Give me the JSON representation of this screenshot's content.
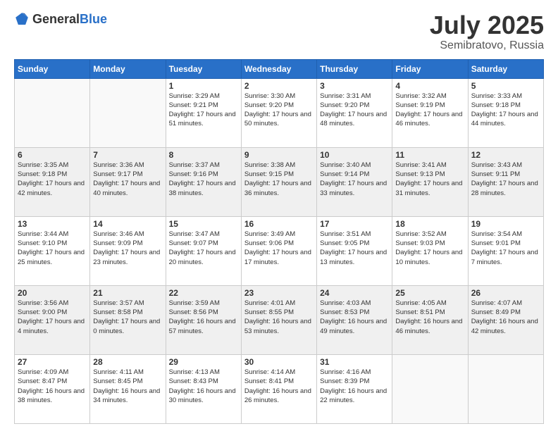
{
  "header": {
    "logo_general": "General",
    "logo_blue": "Blue",
    "title": "July 2025",
    "subtitle": "Semibratovo, Russia"
  },
  "days_of_week": [
    "Sunday",
    "Monday",
    "Tuesday",
    "Wednesday",
    "Thursday",
    "Friday",
    "Saturday"
  ],
  "weeks": [
    [
      {
        "day": "",
        "sunrise": "",
        "sunset": "",
        "daylight": "",
        "empty": true
      },
      {
        "day": "",
        "sunrise": "",
        "sunset": "",
        "daylight": "",
        "empty": true
      },
      {
        "day": "1",
        "sunrise": "Sunrise: 3:29 AM",
        "sunset": "Sunset: 9:21 PM",
        "daylight": "Daylight: 17 hours and 51 minutes.",
        "empty": false
      },
      {
        "day": "2",
        "sunrise": "Sunrise: 3:30 AM",
        "sunset": "Sunset: 9:20 PM",
        "daylight": "Daylight: 17 hours and 50 minutes.",
        "empty": false
      },
      {
        "day": "3",
        "sunrise": "Sunrise: 3:31 AM",
        "sunset": "Sunset: 9:20 PM",
        "daylight": "Daylight: 17 hours and 48 minutes.",
        "empty": false
      },
      {
        "day": "4",
        "sunrise": "Sunrise: 3:32 AM",
        "sunset": "Sunset: 9:19 PM",
        "daylight": "Daylight: 17 hours and 46 minutes.",
        "empty": false
      },
      {
        "day": "5",
        "sunrise": "Sunrise: 3:33 AM",
        "sunset": "Sunset: 9:18 PM",
        "daylight": "Daylight: 17 hours and 44 minutes.",
        "empty": false
      }
    ],
    [
      {
        "day": "6",
        "sunrise": "Sunrise: 3:35 AM",
        "sunset": "Sunset: 9:18 PM",
        "daylight": "Daylight: 17 hours and 42 minutes.",
        "empty": false
      },
      {
        "day": "7",
        "sunrise": "Sunrise: 3:36 AM",
        "sunset": "Sunset: 9:17 PM",
        "daylight": "Daylight: 17 hours and 40 minutes.",
        "empty": false
      },
      {
        "day": "8",
        "sunrise": "Sunrise: 3:37 AM",
        "sunset": "Sunset: 9:16 PM",
        "daylight": "Daylight: 17 hours and 38 minutes.",
        "empty": false
      },
      {
        "day": "9",
        "sunrise": "Sunrise: 3:38 AM",
        "sunset": "Sunset: 9:15 PM",
        "daylight": "Daylight: 17 hours and 36 minutes.",
        "empty": false
      },
      {
        "day": "10",
        "sunrise": "Sunrise: 3:40 AM",
        "sunset": "Sunset: 9:14 PM",
        "daylight": "Daylight: 17 hours and 33 minutes.",
        "empty": false
      },
      {
        "day": "11",
        "sunrise": "Sunrise: 3:41 AM",
        "sunset": "Sunset: 9:13 PM",
        "daylight": "Daylight: 17 hours and 31 minutes.",
        "empty": false
      },
      {
        "day": "12",
        "sunrise": "Sunrise: 3:43 AM",
        "sunset": "Sunset: 9:11 PM",
        "daylight": "Daylight: 17 hours and 28 minutes.",
        "empty": false
      }
    ],
    [
      {
        "day": "13",
        "sunrise": "Sunrise: 3:44 AM",
        "sunset": "Sunset: 9:10 PM",
        "daylight": "Daylight: 17 hours and 25 minutes.",
        "empty": false
      },
      {
        "day": "14",
        "sunrise": "Sunrise: 3:46 AM",
        "sunset": "Sunset: 9:09 PM",
        "daylight": "Daylight: 17 hours and 23 minutes.",
        "empty": false
      },
      {
        "day": "15",
        "sunrise": "Sunrise: 3:47 AM",
        "sunset": "Sunset: 9:07 PM",
        "daylight": "Daylight: 17 hours and 20 minutes.",
        "empty": false
      },
      {
        "day": "16",
        "sunrise": "Sunrise: 3:49 AM",
        "sunset": "Sunset: 9:06 PM",
        "daylight": "Daylight: 17 hours and 17 minutes.",
        "empty": false
      },
      {
        "day": "17",
        "sunrise": "Sunrise: 3:51 AM",
        "sunset": "Sunset: 9:05 PM",
        "daylight": "Daylight: 17 hours and 13 minutes.",
        "empty": false
      },
      {
        "day": "18",
        "sunrise": "Sunrise: 3:52 AM",
        "sunset": "Sunset: 9:03 PM",
        "daylight": "Daylight: 17 hours and 10 minutes.",
        "empty": false
      },
      {
        "day": "19",
        "sunrise": "Sunrise: 3:54 AM",
        "sunset": "Sunset: 9:01 PM",
        "daylight": "Daylight: 17 hours and 7 minutes.",
        "empty": false
      }
    ],
    [
      {
        "day": "20",
        "sunrise": "Sunrise: 3:56 AM",
        "sunset": "Sunset: 9:00 PM",
        "daylight": "Daylight: 17 hours and 4 minutes.",
        "empty": false
      },
      {
        "day": "21",
        "sunrise": "Sunrise: 3:57 AM",
        "sunset": "Sunset: 8:58 PM",
        "daylight": "Daylight: 17 hours and 0 minutes.",
        "empty": false
      },
      {
        "day": "22",
        "sunrise": "Sunrise: 3:59 AM",
        "sunset": "Sunset: 8:56 PM",
        "daylight": "Daylight: 16 hours and 57 minutes.",
        "empty": false
      },
      {
        "day": "23",
        "sunrise": "Sunrise: 4:01 AM",
        "sunset": "Sunset: 8:55 PM",
        "daylight": "Daylight: 16 hours and 53 minutes.",
        "empty": false
      },
      {
        "day": "24",
        "sunrise": "Sunrise: 4:03 AM",
        "sunset": "Sunset: 8:53 PM",
        "daylight": "Daylight: 16 hours and 49 minutes.",
        "empty": false
      },
      {
        "day": "25",
        "sunrise": "Sunrise: 4:05 AM",
        "sunset": "Sunset: 8:51 PM",
        "daylight": "Daylight: 16 hours and 46 minutes.",
        "empty": false
      },
      {
        "day": "26",
        "sunrise": "Sunrise: 4:07 AM",
        "sunset": "Sunset: 8:49 PM",
        "daylight": "Daylight: 16 hours and 42 minutes.",
        "empty": false
      }
    ],
    [
      {
        "day": "27",
        "sunrise": "Sunrise: 4:09 AM",
        "sunset": "Sunset: 8:47 PM",
        "daylight": "Daylight: 16 hours and 38 minutes.",
        "empty": false
      },
      {
        "day": "28",
        "sunrise": "Sunrise: 4:11 AM",
        "sunset": "Sunset: 8:45 PM",
        "daylight": "Daylight: 16 hours and 34 minutes.",
        "empty": false
      },
      {
        "day": "29",
        "sunrise": "Sunrise: 4:13 AM",
        "sunset": "Sunset: 8:43 PM",
        "daylight": "Daylight: 16 hours and 30 minutes.",
        "empty": false
      },
      {
        "day": "30",
        "sunrise": "Sunrise: 4:14 AM",
        "sunset": "Sunset: 8:41 PM",
        "daylight": "Daylight: 16 hours and 26 minutes.",
        "empty": false
      },
      {
        "day": "31",
        "sunrise": "Sunrise: 4:16 AM",
        "sunset": "Sunset: 8:39 PM",
        "daylight": "Daylight: 16 hours and 22 minutes.",
        "empty": false
      },
      {
        "day": "",
        "sunrise": "",
        "sunset": "",
        "daylight": "",
        "empty": true
      },
      {
        "day": "",
        "sunrise": "",
        "sunset": "",
        "daylight": "",
        "empty": true
      }
    ]
  ]
}
